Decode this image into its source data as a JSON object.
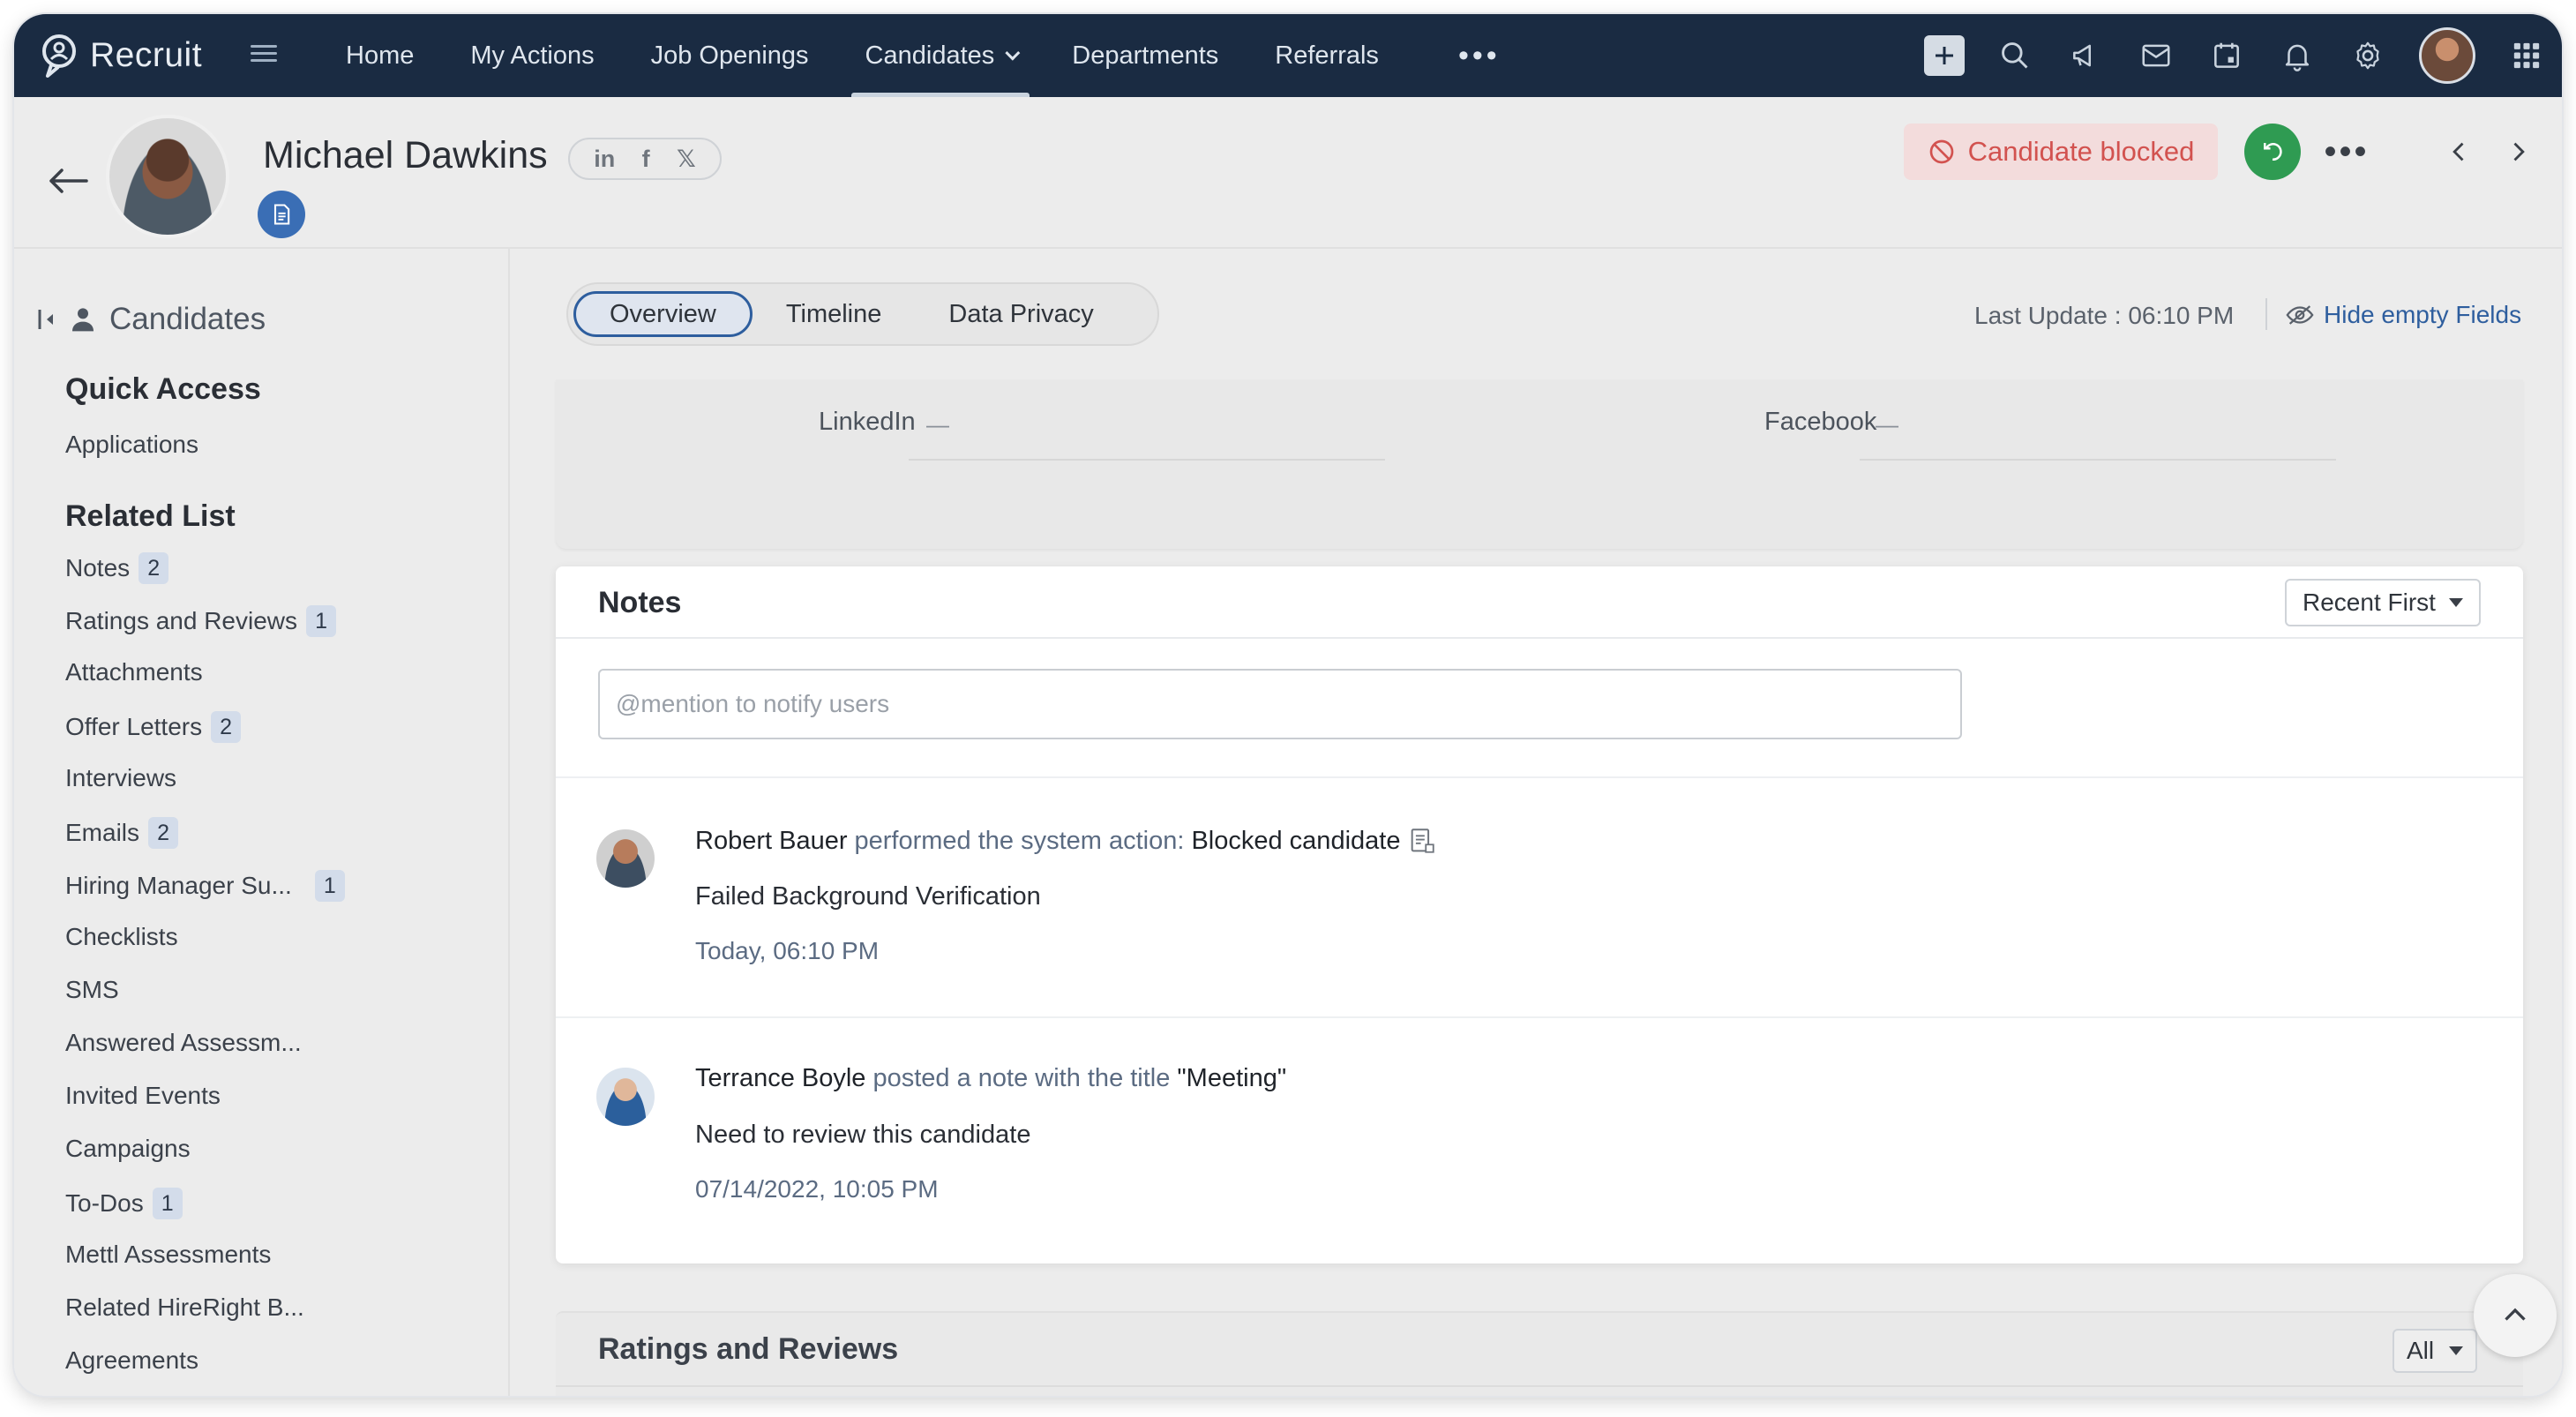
{
  "app": {
    "brand": "Recruit"
  },
  "nav": {
    "links": [
      {
        "label": "Home",
        "active": false
      },
      {
        "label": "My Actions",
        "active": false
      },
      {
        "label": "Job Openings",
        "active": false
      },
      {
        "label": "Candidates",
        "active": true
      },
      {
        "label": "Departments",
        "active": false
      },
      {
        "label": "Referrals",
        "active": false
      }
    ],
    "more": "•••",
    "icons": [
      "plus-icon",
      "search-icon",
      "megaphone-icon",
      "mail-icon",
      "calendar-icon",
      "bell-icon",
      "gear-icon",
      "avatar",
      "apps-grid-icon"
    ]
  },
  "record": {
    "name": "Michael Dawkins",
    "social": {
      "linkedin": "in",
      "facebook": "f",
      "x": "𝕏"
    },
    "status": "Candidate blocked",
    "more": "•••"
  },
  "sidebar": {
    "title": "Candidates",
    "quick_access_heading": "Quick Access",
    "quick_access": [
      "Applications"
    ],
    "related_heading": "Related List",
    "items": [
      {
        "label": "Notes",
        "count": "2"
      },
      {
        "label": "Ratings and Reviews",
        "count": "1"
      },
      {
        "label": "Attachments",
        "count": ""
      },
      {
        "label": "Offer Letters",
        "count": "2"
      },
      {
        "label": "Interviews",
        "count": ""
      },
      {
        "label": "Emails",
        "count": "2"
      },
      {
        "label": "Hiring Manager Su...",
        "count": "1"
      },
      {
        "label": "Checklists",
        "count": ""
      },
      {
        "label": "SMS",
        "count": ""
      },
      {
        "label": "Answered Assessm...",
        "count": ""
      },
      {
        "label": "Invited Events",
        "count": ""
      },
      {
        "label": "Campaigns",
        "count": ""
      },
      {
        "label": "To-Dos",
        "count": "1"
      },
      {
        "label": "Mettl Assessments",
        "count": ""
      },
      {
        "label": "Related HireRight B...",
        "count": ""
      },
      {
        "label": "Agreements",
        "count": ""
      }
    ]
  },
  "tabs": [
    {
      "label": "Overview",
      "active": true
    },
    {
      "label": "Timeline",
      "active": false
    },
    {
      "label": "Data Privacy",
      "active": false
    }
  ],
  "last_update": "Last Update : 06:10 PM",
  "hide_empty": "Hide empty Fields",
  "fields": [
    {
      "label": "LinkedIn",
      "value": "—"
    },
    {
      "label": "Facebook",
      "value": "—"
    }
  ],
  "notes": {
    "title": "Notes",
    "sort": "Recent First",
    "mention_placeholder": "@mention to notify users",
    "entries": [
      {
        "author": "Robert Bauer",
        "action": "performed the system action:",
        "subject": "Blocked candidate",
        "body": "Failed Background Verification",
        "time": "Today, 06:10 PM"
      },
      {
        "author": "Terrance Boyle",
        "action": "posted a note with the title",
        "subject": "\"Meeting\"",
        "body": "Need to review this candidate",
        "time": "07/14/2022, 10:05 PM"
      }
    ]
  },
  "ratings": {
    "title": "Ratings and Reviews",
    "filter": "All"
  },
  "colors": {
    "nav_bg": "#1a2b42",
    "accent": "#2e5e9e",
    "blocked": "#d2524f",
    "success": "#2f9b52"
  }
}
